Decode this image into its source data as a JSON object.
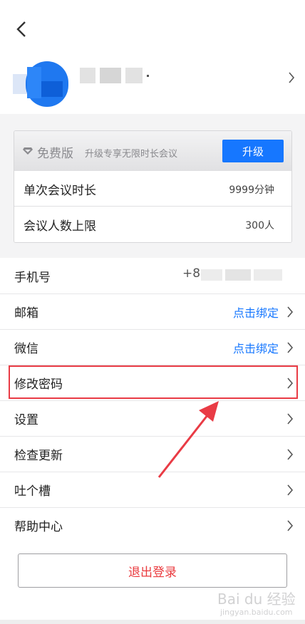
{
  "header": {},
  "plan": {
    "name": "免费版",
    "description": "升级专享无限时长会议",
    "upgrade_label": "升级",
    "quotas": [
      {
        "label": "单次会议时长",
        "value": "9999分钟"
      },
      {
        "label": "会议人数上限",
        "value": "300人"
      }
    ]
  },
  "settings": {
    "phone": {
      "label": "手机号",
      "value_prefix": "+8"
    },
    "email": {
      "label": "邮箱",
      "action": "点击绑定"
    },
    "wechat": {
      "label": "微信",
      "action": "点击绑定"
    },
    "change_password": {
      "label": "修改密码"
    },
    "settings_item": {
      "label": "设置"
    },
    "check_update": {
      "label": "检查更新"
    },
    "feedback": {
      "label": "吐个槽"
    },
    "help_center": {
      "label": "帮助中心"
    }
  },
  "logout_label": "退出登录",
  "watermark": {
    "brand": "Bai du 经验",
    "url": "jingyan.baidu.com"
  },
  "colors": {
    "accent": "#1677ff",
    "danger": "#ea3a3e",
    "annotation": "#e93b45"
  }
}
